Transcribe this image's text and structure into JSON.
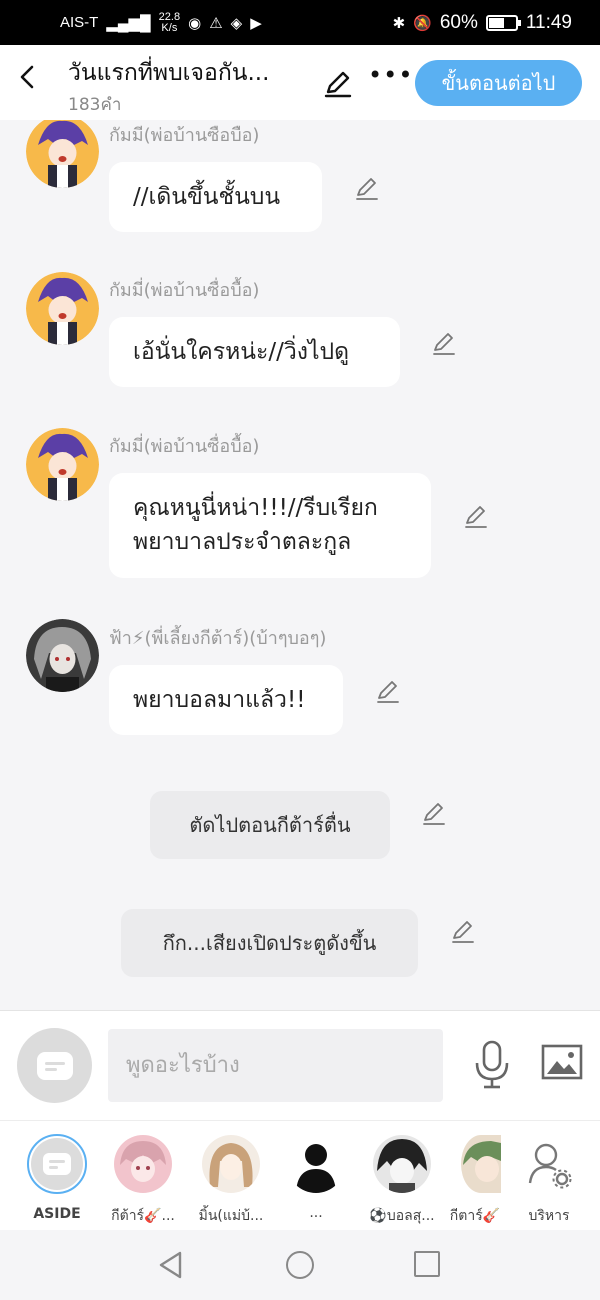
{
  "status_bar": {
    "carrier": "AIS-T",
    "speed_value": "22.8",
    "speed_unit": "K/s",
    "battery": "60%",
    "battery_level": 0.6,
    "time": "11:49"
  },
  "header": {
    "title": "วันแรกที่พบเจอกัน...",
    "subtitle": "183คำ",
    "next_label": "ขั้นตอนต่อไป"
  },
  "messages": [
    {
      "name": "กัมมี(พ่อบ้านซือบือ)",
      "text": "//เดินขึ้นชั้นบน"
    },
    {
      "name": "กัมมี่(พ่อบ้านซื่อบื้อ)",
      "text": "เอ้นั่นใครหน่ะ//วิ่งไปดู"
    },
    {
      "name": "กัมมี่(พ่อบ้านซื่อบื้อ)",
      "text_line1": "คุณหนูนี่หน่า!!!//รีบเรียก",
      "text_line2": "พยาบาลประจำตละกูล"
    },
    {
      "name": "ฟ้า⚡(พี่เลี้ยงกีต้าร์)(บ้าๆบอๆ)",
      "text": "พยาบอลมาแล้ว!!"
    }
  ],
  "narrations": [
    "ตัดไปตอนกีต้าร์ตื่น",
    "กึก...เสียงเปิดประตูดังขึ้น"
  ],
  "input": {
    "placeholder": "พูดอะไรบ้าง"
  },
  "characters": [
    {
      "label": "ASIDE"
    },
    {
      "label": "กีต้าร์🎸..."
    },
    {
      "label": "มิ้น(แม่บ้..."
    },
    {
      "label": "..."
    },
    {
      "label": "⚽บอลสุ..."
    },
    {
      "label": "กีตาร์🎸"
    },
    {
      "label": "บริหาร"
    }
  ],
  "colors": {
    "accent": "#5ab0f2",
    "bubble": "#ffffff",
    "narration": "#ebebed",
    "background": "#f5f5f7"
  }
}
